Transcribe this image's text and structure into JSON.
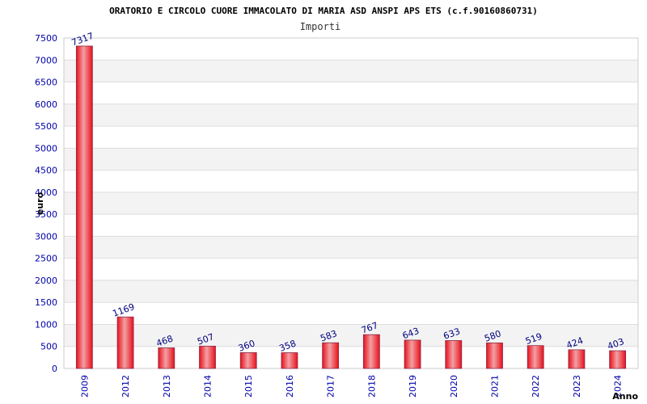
{
  "chart_data": {
    "type": "bar",
    "title": "ORATORIO E CIRCOLO CUORE IMMACOLATO DI MARIA ASD ANSPI APS ETS (c.f.90160860731)",
    "subtitle": "Importi",
    "xlabel": "Anno",
    "ylabel": "euro",
    "categories": [
      "2009",
      "2012",
      "2013",
      "2014",
      "2015",
      "2016",
      "2017",
      "2018",
      "2019",
      "2020",
      "2021",
      "2022",
      "2023",
      "2024"
    ],
    "values": [
      7317,
      1169,
      468,
      507,
      360,
      358,
      583,
      767,
      643,
      633,
      580,
      519,
      424,
      403
    ],
    "ylim": [
      0,
      7500
    ],
    "yticks": [
      0,
      500,
      1000,
      1500,
      2000,
      2500,
      3000,
      3500,
      4000,
      4500,
      5000,
      5500,
      6000,
      6500,
      7000,
      7500
    ],
    "grid": true,
    "colors": {
      "bar": "#e8101a",
      "bar_highlight": "#f2a0a4",
      "bar_edge": "#8a2a4a",
      "band_alt": "#f3f3f3",
      "gridline": "#dddddd",
      "tick_text": "#0000aa",
      "label_text": "#000080"
    }
  }
}
